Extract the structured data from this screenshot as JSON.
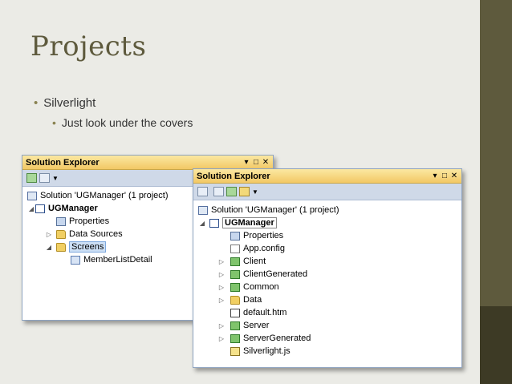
{
  "slide": {
    "title": "Projects",
    "bullet1": "Silverlight",
    "bullet2": "Just look under the covers"
  },
  "panel_left": {
    "title": "Solution Explorer",
    "controls": [
      "▾",
      "□",
      "✕"
    ],
    "items": [
      {
        "label": "Solution 'UGManager' (1 project)",
        "icon": "solution-icon"
      },
      {
        "label": "UGManager",
        "icon": "project-icon",
        "expander": "◢"
      },
      {
        "label": "Properties",
        "icon": "properties-icon"
      },
      {
        "label": "Data Sources",
        "icon": "folder-icon",
        "expander": "▷"
      },
      {
        "label": "Screens",
        "icon": "folder-icon",
        "expander": "◢"
      },
      {
        "label": "MemberListDetail",
        "icon": "screen-icon"
      }
    ]
  },
  "panel_right": {
    "title": "Solution Explorer",
    "controls": [
      "▾",
      "□",
      "✕"
    ],
    "items": [
      {
        "label": "Solution 'UGManager' (1 project)",
        "icon": "solution-icon"
      },
      {
        "label": "UGManager",
        "icon": "project-icon",
        "expander": "◢"
      },
      {
        "label": "Properties",
        "icon": "properties-icon"
      },
      {
        "label": "App.config",
        "icon": "config-icon"
      },
      {
        "label": "Client",
        "icon": "csharp-project-icon",
        "expander": "▷"
      },
      {
        "label": "ClientGenerated",
        "icon": "csharp-project-icon",
        "expander": "▷"
      },
      {
        "label": "Common",
        "icon": "csharp-project-icon",
        "expander": "▷"
      },
      {
        "label": "Data",
        "icon": "folder-icon",
        "expander": "▷"
      },
      {
        "label": "default.htm",
        "icon": "web-file-icon"
      },
      {
        "label": "Server",
        "icon": "csharp-project-icon",
        "expander": "▷"
      },
      {
        "label": "ServerGenerated",
        "icon": "csharp-project-icon",
        "expander": "▷"
      },
      {
        "label": "Silverlight.js",
        "icon": "js-file-icon"
      }
    ]
  }
}
